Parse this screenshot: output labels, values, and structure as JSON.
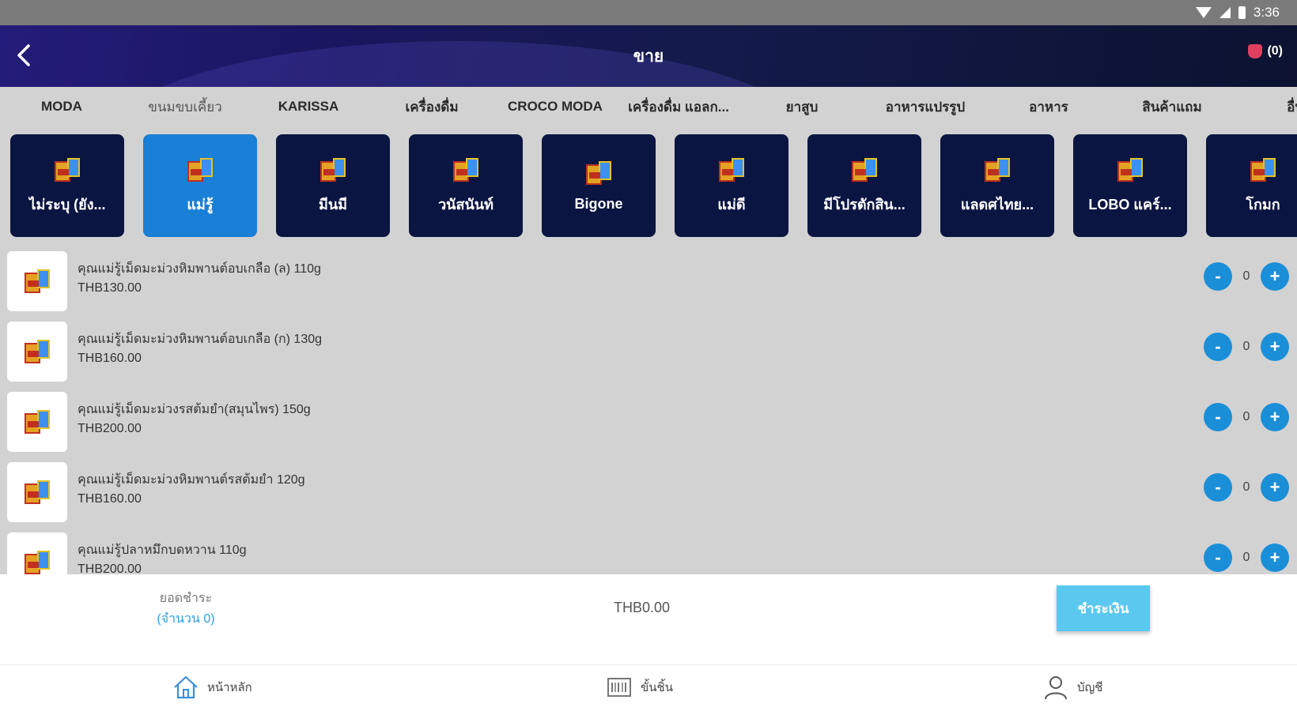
{
  "status_bar": {
    "time": "3:36"
  },
  "header": {
    "title": "ขาย",
    "cart_count": "(0)"
  },
  "tabs": [
    "MODA",
    "ขนมขบเคี้ยว",
    "KARISSA",
    "เครื่องดื่ม",
    "CROCO MODA",
    "เครื่องดื่ม แอลก...",
    "ยาสูบ",
    "อาหารแปรรูป",
    "อาหาร",
    "สินค้าแถม",
    "อื่น"
  ],
  "brands": [
    {
      "name": "ไม่ระบุ (ยัง..."
    },
    {
      "name": "แม่รู้",
      "active": true
    },
    {
      "name": "มีนมี"
    },
    {
      "name": "วนัสนันท์"
    },
    {
      "name": "Bigone"
    },
    {
      "name": "แม่ดี"
    },
    {
      "name": "มีโปรตักสิน..."
    },
    {
      "name": "แลดศไทย..."
    },
    {
      "name": "LOBO แคร์..."
    },
    {
      "name": "โกมก"
    }
  ],
  "products": [
    {
      "name": "คุณแม่รู้เม็ดมะม่วงหิมพานต์อบเกลือ (ล) 110g",
      "price": "THB130.00",
      "qty": "0"
    },
    {
      "name": "คุณแม่รู้เม็ดมะม่วงหิมพานต์อบเกลือ (ก) 130g",
      "price": "THB160.00",
      "qty": "0"
    },
    {
      "name": "คุณแม่รู้เม็ดมะม่วงรสต้มยำ(สมุนไพร) 150g",
      "price": "THB200.00",
      "qty": "0"
    },
    {
      "name": "คุณแม่รู้เม็ดมะม่วงหิมพานต์รสต้มยำ 120g",
      "price": "THB160.00",
      "qty": "0"
    },
    {
      "name": "คุณแม่รู้ปลาหมึกบดหวาน 110g",
      "price": "THB200.00",
      "qty": "0"
    }
  ],
  "qty_controls": {
    "minus": "-",
    "plus": "+"
  },
  "summary": {
    "label": "ยอดชำระ",
    "count": "(จำนวน 0)",
    "total": "THB0.00",
    "pay_label": "ชำระเงิน"
  },
  "bottom_nav": {
    "home": "หน้าหลัก",
    "register": "ขั้นชิ้น",
    "account": "บัญชี"
  },
  "colors": {
    "header_bg": "#1a1660",
    "brand_card": "#0b1542",
    "brand_active": "#1a7fd6",
    "accent": "#1a8fd8",
    "pay_button": "#5bc8f0"
  }
}
